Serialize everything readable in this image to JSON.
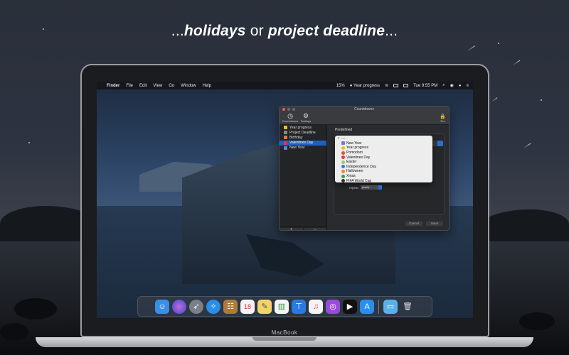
{
  "headline": {
    "prefix": "...",
    "part1": "holidays",
    "middle": " or ",
    "part2": "project deadline",
    "suffix": "..."
  },
  "device_label": "MacBook",
  "menubar": {
    "items": [
      "Finder",
      "File",
      "Edit",
      "View",
      "Go",
      "Window",
      "Help"
    ],
    "status_percent": "15%",
    "status_label": "Year progress",
    "clock": "Tue 9:55 PM"
  },
  "window": {
    "title": "Countdowns",
    "toolbar": [
      {
        "label": "Countdowns",
        "icon": "clock-icon"
      },
      {
        "label": "Settings",
        "icon": "gear-icon"
      }
    ],
    "pro_label": "Pro",
    "sidebar": [
      {
        "label": "Year progress",
        "color": "#f0c02a",
        "selected": false
      },
      {
        "label": "Project Deadline",
        "color": "#888888",
        "selected": false
      },
      {
        "label": "Birthday",
        "color": "#e07a3a",
        "selected": false
      },
      {
        "label": "Valentines Day",
        "color": "#e0344a",
        "selected": true
      },
      {
        "label": "New Year",
        "color": "#6a7ed8",
        "selected": false
      }
    ],
    "sidebar_add": "+",
    "sidebar_remove": "−",
    "predefined_label": "Predefined",
    "dropdown": [
      {
        "label": "---",
        "checked": true,
        "color": ""
      },
      {
        "label": "New Year",
        "checked": false,
        "color": "#6a7ed8"
      },
      {
        "label": "Year progress",
        "checked": false,
        "color": "#f0c02a"
      },
      {
        "label": "Pomodoro",
        "checked": false,
        "color": "#e0503a"
      },
      {
        "label": "Valentines Day",
        "checked": false,
        "color": "#e0344a"
      },
      {
        "label": "Easter",
        "checked": false,
        "color": "#9ad06a"
      },
      {
        "label": "Independence Day",
        "checked": false,
        "color": "#3a7ad0"
      },
      {
        "label": "Halloween",
        "checked": false,
        "color": "#f08a2a"
      },
      {
        "label": "Xmas",
        "checked": false,
        "color": "#3aa04a"
      },
      {
        "label": "FIFA World Cup",
        "checked": false,
        "color": "#333333"
      }
    ],
    "repeat_label": "repeat",
    "repeat_value": "yearly",
    "cancel_label": "Cancel",
    "save_label": "Save"
  }
}
